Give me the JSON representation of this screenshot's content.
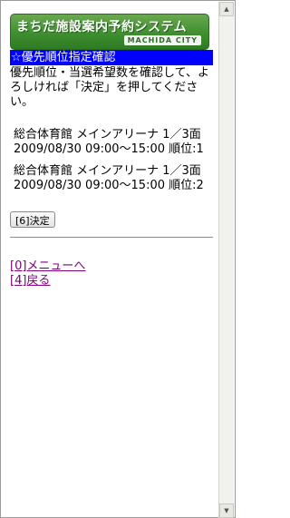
{
  "logo": {
    "main": "まちだ施設案内予約システム",
    "sub": "MACHIDA CITY"
  },
  "heading": "☆優先順位指定確認",
  "instructions": "優先順位・当選希望数を確認して、よろしければ「決定」を押してください。",
  "entries": [
    "総合体育館 メインアリーナ 1／3面 2009/08/30 09:00～15:00 順位:1",
    "総合体育館 メインアリーナ 1／3面 2009/08/30 09:00～15:00 順位:2"
  ],
  "decide_button": "[6]決定",
  "links": {
    "menu": "[0]メニューへ",
    "back": "[4]戻る"
  },
  "colors": {
    "title_bg": "#0000ff",
    "logo_green": "#3f8f2f",
    "link_visited": "#800080"
  }
}
